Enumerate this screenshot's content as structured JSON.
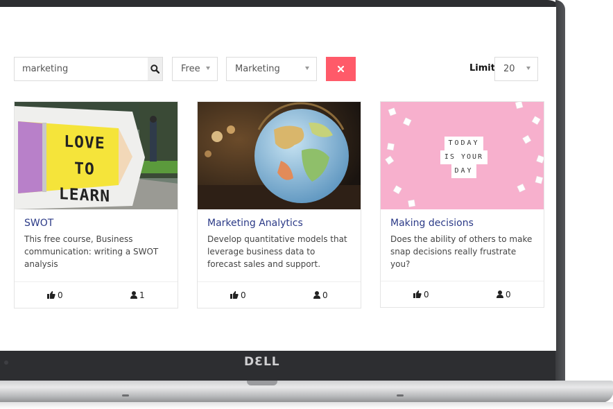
{
  "search": {
    "value": "marketing",
    "placeholder": ""
  },
  "filters": {
    "price": "Free",
    "category": "Marketing",
    "limit_label": "Limit",
    "limit_value": "20"
  },
  "brand": "DƐLL",
  "cards": [
    {
      "title": "SWOT",
      "description": "This free course, Business communication: writing a SWOT analysis",
      "likes": "0",
      "users": "1",
      "image_text": "LOVE TO LEARN"
    },
    {
      "title": "Marketing Analytics",
      "description": "Develop quantitative models that leverage business data to forecast sales and support.",
      "likes": "0",
      "users": "0"
    },
    {
      "title": "Making decisions",
      "description": "Does the ability of others to make snap decisions really frustrate you?",
      "likes": "0",
      "users": "0",
      "image_text": [
        "TODAY",
        "IS YOUR",
        "DAY"
      ]
    }
  ],
  "colors": {
    "accent": "#2b3a87",
    "clear": "#ff5a69"
  }
}
